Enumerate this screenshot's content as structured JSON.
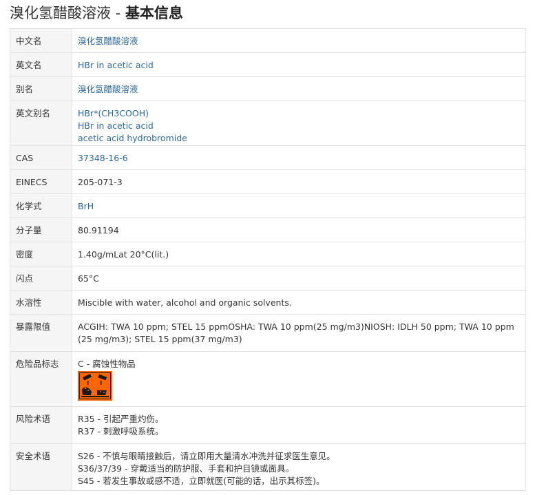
{
  "title": {
    "name": "溴化氢醋酸溶液",
    "separator": " - ",
    "section": "基本信息"
  },
  "rows": {
    "cn_name": {
      "label": "中文名",
      "value": "溴化氢醋酸溶液"
    },
    "en_name": {
      "label": "英文名",
      "value": "HBr in acetic acid"
    },
    "alias": {
      "label": "别名",
      "value": "溴化氢醋酸溶液"
    },
    "en_alias": {
      "label": "英文别名",
      "values": [
        "HBr*(CH3COOH)",
        "HBr in acetic acid",
        "acetic acid hydrobromide"
      ]
    },
    "cas": {
      "label": "CAS",
      "value": "37348-16-6"
    },
    "einecs": {
      "label": "EINECS",
      "value": "205-071-3"
    },
    "formula": {
      "label": "化学式",
      "value": "BrH"
    },
    "mw": {
      "label": "分子量",
      "value": "80.91194"
    },
    "density": {
      "label": "密度",
      "value": "1.40g/mLat 20°C(lit.)"
    },
    "flash": {
      "label": "闪点",
      "value": "65°C"
    },
    "solubility": {
      "label": "水溶性",
      "value": "Miscible with water, alcohol and organic solvents."
    },
    "exposure": {
      "label": "暴露限值",
      "value": "ACGIH: TWA 10 ppm; STEL 15 ppmOSHA: TWA 10 ppm(25 mg/m3)NIOSH: IDLH 50 ppm; TWA 10 ppm (25 mg/m3); STEL 15 ppm(37 mg/m3)"
    },
    "hazard": {
      "label": "危险品标志",
      "value": "C - 腐蚀性物品",
      "icon": "corrosive-hazard-icon",
      "icon_color": "#ff6600"
    },
    "risk": {
      "label": "风险术语",
      "values": [
        "R35 - 引起严重灼伤。",
        "R37 - 刺激呼吸系统。"
      ]
    },
    "safety": {
      "label": "安全术语",
      "values": [
        "S26 - 不慎与眼睛接触后，请立即用大量清水冲洗并征求医生意见。",
        "S36/37/39 - 穿戴适当的防护服、手套和护目镜或面具。",
        "S45 - 若发生事故或感不适，立即就医(可能的话，出示其标签)。"
      ]
    }
  },
  "colors": {
    "link": "#2d6a9f",
    "key_bg": "#f5f5f5",
    "border": "#e2e2e2",
    "hazard": "#ff6600"
  }
}
